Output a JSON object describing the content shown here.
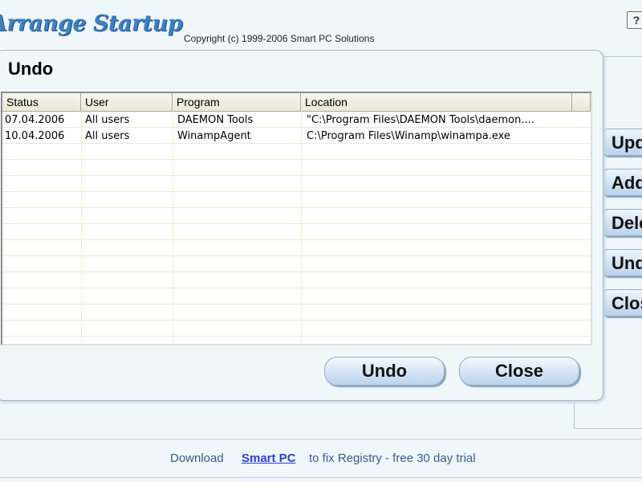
{
  "header": {
    "logo_text": "Arrange Startup",
    "copyright": "Copyright (c) 1999-2006 Smart PC Solutions",
    "help_label": "?"
  },
  "side_buttons": [
    {
      "label": "Update"
    },
    {
      "label": "Add"
    },
    {
      "label": "Delete"
    },
    {
      "label": "Undo"
    },
    {
      "label": "Close"
    }
  ],
  "dialog": {
    "title": "Undo",
    "columns": [
      "Status",
      "User",
      "Program",
      "Location"
    ],
    "rows": [
      {
        "status": "07.04.2006",
        "user": "All users",
        "program": "DAEMON Tools",
        "location": "\"C:\\Program Files\\DAEMON Tools\\daemon...."
      },
      {
        "status": "10.04.2006",
        "user": "All users",
        "program": "WinampAgent",
        "location": "C:\\Program Files\\Winamp\\winampa.exe"
      }
    ],
    "undo_label": "Undo",
    "close_label": "Close"
  },
  "footer": {
    "text_before": "Download",
    "link_text": "Smart PC",
    "text_after": "to fix Registry - free 30 day trial"
  }
}
